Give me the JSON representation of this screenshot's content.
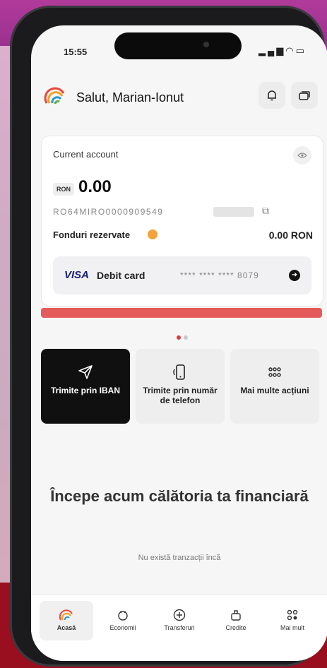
{
  "status_bar": {
    "time": "15:55"
  },
  "header": {
    "greeting": "Salut, Marian-Ionut"
  },
  "account_card": {
    "title": "Current account",
    "currency": "RON",
    "balance": "0.00",
    "iban": "RO64MIRO0000909549",
    "reserved_label": "Fonduri rezervate",
    "reserved_value": "0.00 RON",
    "card_brand": "VISA",
    "card_label": "Debit card",
    "card_number": "**** **** **** 8079"
  },
  "actions": [
    {
      "label": "Trimite prin IBAN"
    },
    {
      "label": "Trimite prin număr de telefon"
    },
    {
      "label": "Mai multe acțiuni"
    }
  ],
  "empty_state": {
    "headline": "Începe acum călătoria ta financiară",
    "message": "Nu există tranzacții încă"
  },
  "nav": [
    {
      "label": "Acasă",
      "icon": "home-icon"
    },
    {
      "label": "Economii",
      "icon": "piggy-icon"
    },
    {
      "label": "Transferuri",
      "icon": "transfer-icon"
    },
    {
      "label": "Credite",
      "icon": "credit-icon"
    },
    {
      "label": "Mai mult",
      "icon": "more-icon"
    }
  ],
  "colors": {
    "accent_red": "#e55a5a",
    "warning": "#f2a43a",
    "visa_blue": "#1a1f71"
  }
}
